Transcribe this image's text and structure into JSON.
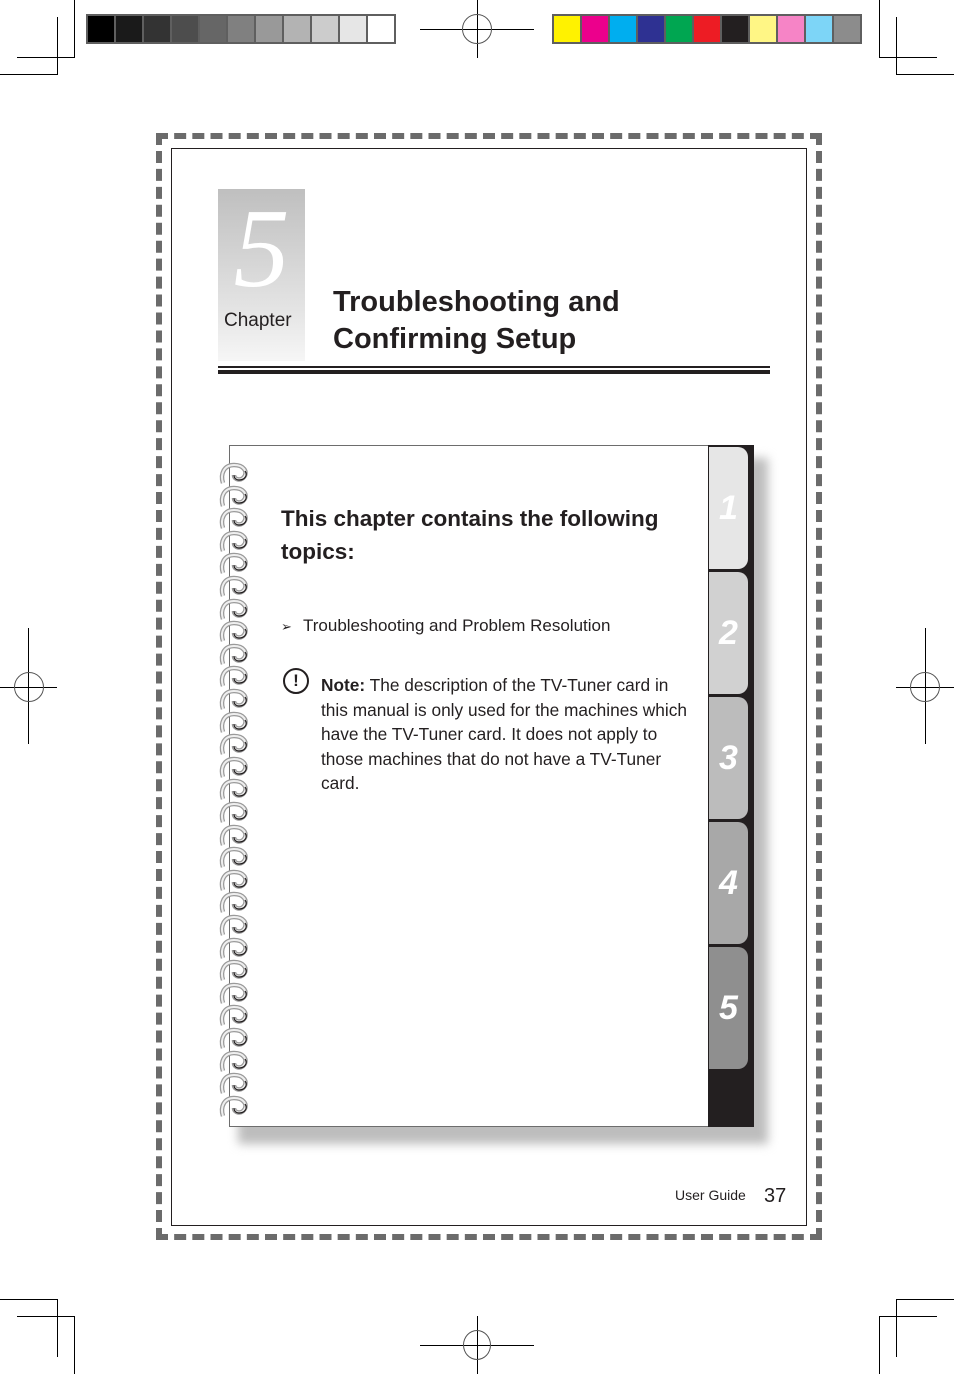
{
  "print_marks": {
    "grayscale_swatches": [
      "#000000",
      "#1a1a1a",
      "#333333",
      "#4d4d4d",
      "#666666",
      "#808080",
      "#999999",
      "#b3b3b3",
      "#cccccc",
      "#e6e6e6",
      "#ffffff"
    ],
    "color_swatches": [
      "#fff200",
      "#ec008c",
      "#00aeef",
      "#2e3192",
      "#00a651",
      "#ed1c24",
      "#231f20",
      "#fff685",
      "#f684c6",
      "#7dd5f7",
      "#8c8c8c"
    ]
  },
  "chapter": {
    "number": "5",
    "label": "Chapter",
    "title_line1": "Troubleshooting and",
    "title_line2": "Confirming Setup"
  },
  "notebook": {
    "intro": "This chapter contains the following topics:",
    "topics": [
      {
        "bullet": "➢",
        "text": "Troubleshooting and Problem Resolution"
      }
    ],
    "note": {
      "icon": "exclamation-circle-icon",
      "label": "Note:",
      "text": " The description of the TV-Tuner card in this manual is only used for the machines which have the TV-Tuner card. It does not apply to those machines that do not have a TV-Tuner card."
    },
    "tabs": [
      {
        "label": "1",
        "color": "#e6e6e6"
      },
      {
        "label": "2",
        "color": "#d1d1d1"
      },
      {
        "label": "3",
        "color": "#bcbcbc"
      },
      {
        "label": "4",
        "color": "#a8a8a8"
      },
      {
        "label": "5",
        "color": "#8f8f8f",
        "active": true
      }
    ]
  },
  "footer": {
    "guide_label": "User Guide",
    "page_number": "37"
  }
}
